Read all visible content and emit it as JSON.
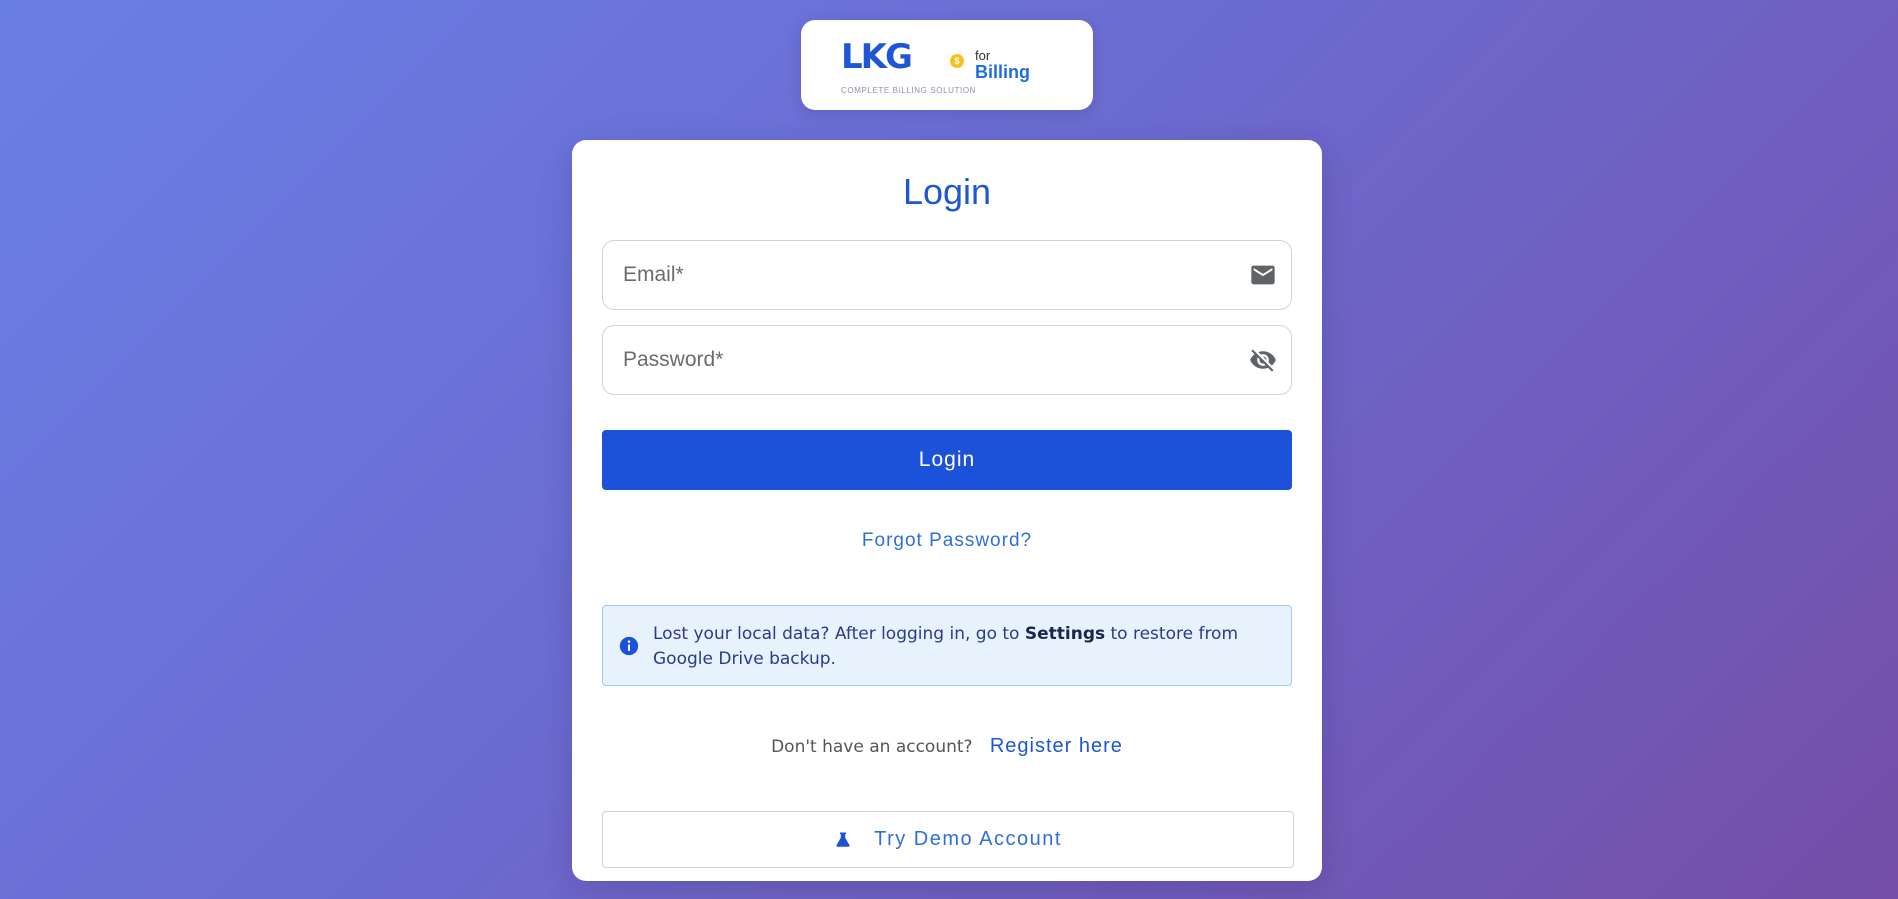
{
  "logo": {
    "brand": "LKG",
    "coin_symbol": "$",
    "for_text": "for",
    "product": "Billing",
    "tagline": "COMPLETE BILLING SOLUTION"
  },
  "login": {
    "title": "Login",
    "email": {
      "placeholder": "Email*",
      "value": "",
      "icon": "mail-icon"
    },
    "password": {
      "placeholder": "Password*",
      "value": "",
      "icon": "eye-off-icon"
    },
    "submit_label": "Login",
    "forgot_label": "Forgot Password?",
    "info": {
      "icon": "info-icon",
      "text_before": "Lost your local data? After logging in, go to ",
      "text_bold": "Settings",
      "text_after": " to restore from Google Drive backup."
    },
    "register": {
      "question": "Don't have an account?",
      "link_label": "Register here"
    },
    "demo": {
      "icon": "flask-icon",
      "label": "Try Demo Account"
    }
  },
  "colors": {
    "primary": "#1c51d9",
    "link": "#2f6fd8",
    "info_bg": "#e7f2fc",
    "info_border": "#9ecbf2",
    "background_start": "#6a7fe6",
    "background_end": "#744ea8"
  }
}
